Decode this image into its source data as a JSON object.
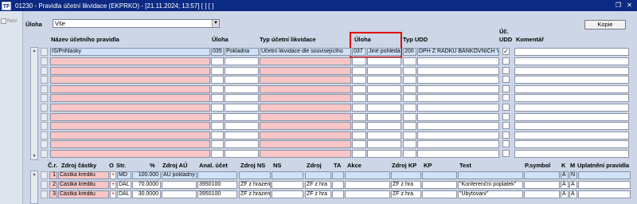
{
  "window": {
    "title": "01230 - Pravidla účetní likvidace (EKPRKO) - [21.11.2024; 13:57]  [ ]  [ ]",
    "app_icon_text": "TF"
  },
  "nav": {
    "label": "Nav"
  },
  "filter": {
    "label": "Úloha",
    "value": "Vše"
  },
  "buttons": {
    "kopie": "Kopie"
  },
  "rules_table": {
    "headers": {
      "nazev": "Název účetního pravidla",
      "uloha": "Úloha",
      "typ_ucetni_likvidace": "Typ účetní likvidace",
      "uloha2": "Úloha",
      "typ_udd": "Typ UDD",
      "uc": "Úč.",
      "udd": "UDD",
      "komentar": "Komentář"
    },
    "rows": [
      {
        "nazev": "IS/Prihlasky",
        "uloha_code": "035",
        "uloha_name": "Pokladna",
        "typ": "Účetní likvidace dle souvisejícího",
        "uloha2_code": "037",
        "uloha2_name": "Jiné pohledá",
        "typ_udd_code": "200",
        "typ_udd_name": "DPH Z ŘÁDKŮ BANKOVNÍCH V",
        "checked": true
      }
    ],
    "empty_rows": 11
  },
  "lines_table": {
    "headers": {
      "cr": "Č.r.",
      "zdroj_castky": "Zdroj částky",
      "o": "O",
      "str": "Str.",
      "pct": "%",
      "zdroj_au": "Zdroj AÚ",
      "anal_ucet": "Anal. účet",
      "zdroj_ns": "Zdroj NS",
      "ns": "NS",
      "zdroj": "Zdroj",
      "ta": "TA",
      "akce": "Akce",
      "zdroj_kp": "Zdroj KP",
      "kp": "KP",
      "text": "Text",
      "psymbol": "P.symbol",
      "k": "K",
      "m": "M",
      "uplatneni": "Uplatnění pravidla"
    },
    "rows": [
      {
        "cr": "1",
        "zdroj": "Částka kreditu",
        "o": "+",
        "str": "MD",
        "pct": "100.000",
        "zdroj_au": "AÚ pokladny",
        "anal": "",
        "zdroj_ns": "",
        "zdroj2": "",
        "zdroj_kp": "",
        "text": "",
        "k": "A",
        "m": "N"
      },
      {
        "cr": "2",
        "zdroj": "Částka kreditu",
        "o": "+",
        "str": "DAL",
        "pct": "70.0000",
        "zdroj_au": "",
        "anal": "3950100",
        "zdroj_ns": "ZF z hrazen",
        "zdroj2": "ZF z hra",
        "zdroj_kp": "ZF z hra",
        "text": "\"Konferenční poplatek\"",
        "k": "A",
        "m": "A"
      },
      {
        "cr": "3",
        "zdroj": "Částka kreditu",
        "o": "+",
        "str": "DAL",
        "pct": "30.0000",
        "zdroj_au": "",
        "anal": "3950100",
        "zdroj_ns": "ZF z hrazen",
        "zdroj2": "ZF z hra",
        "zdroj_kp": "ZF z hra",
        "text": "\"Ubytování\"",
        "k": "A",
        "m": "A"
      }
    ]
  },
  "colors": {
    "titlebar": "#0c2a83",
    "background": "#ccd6e6",
    "required": "#f8c6c6",
    "selected": "#cfe2f7",
    "highlight_box": "#e00000"
  }
}
